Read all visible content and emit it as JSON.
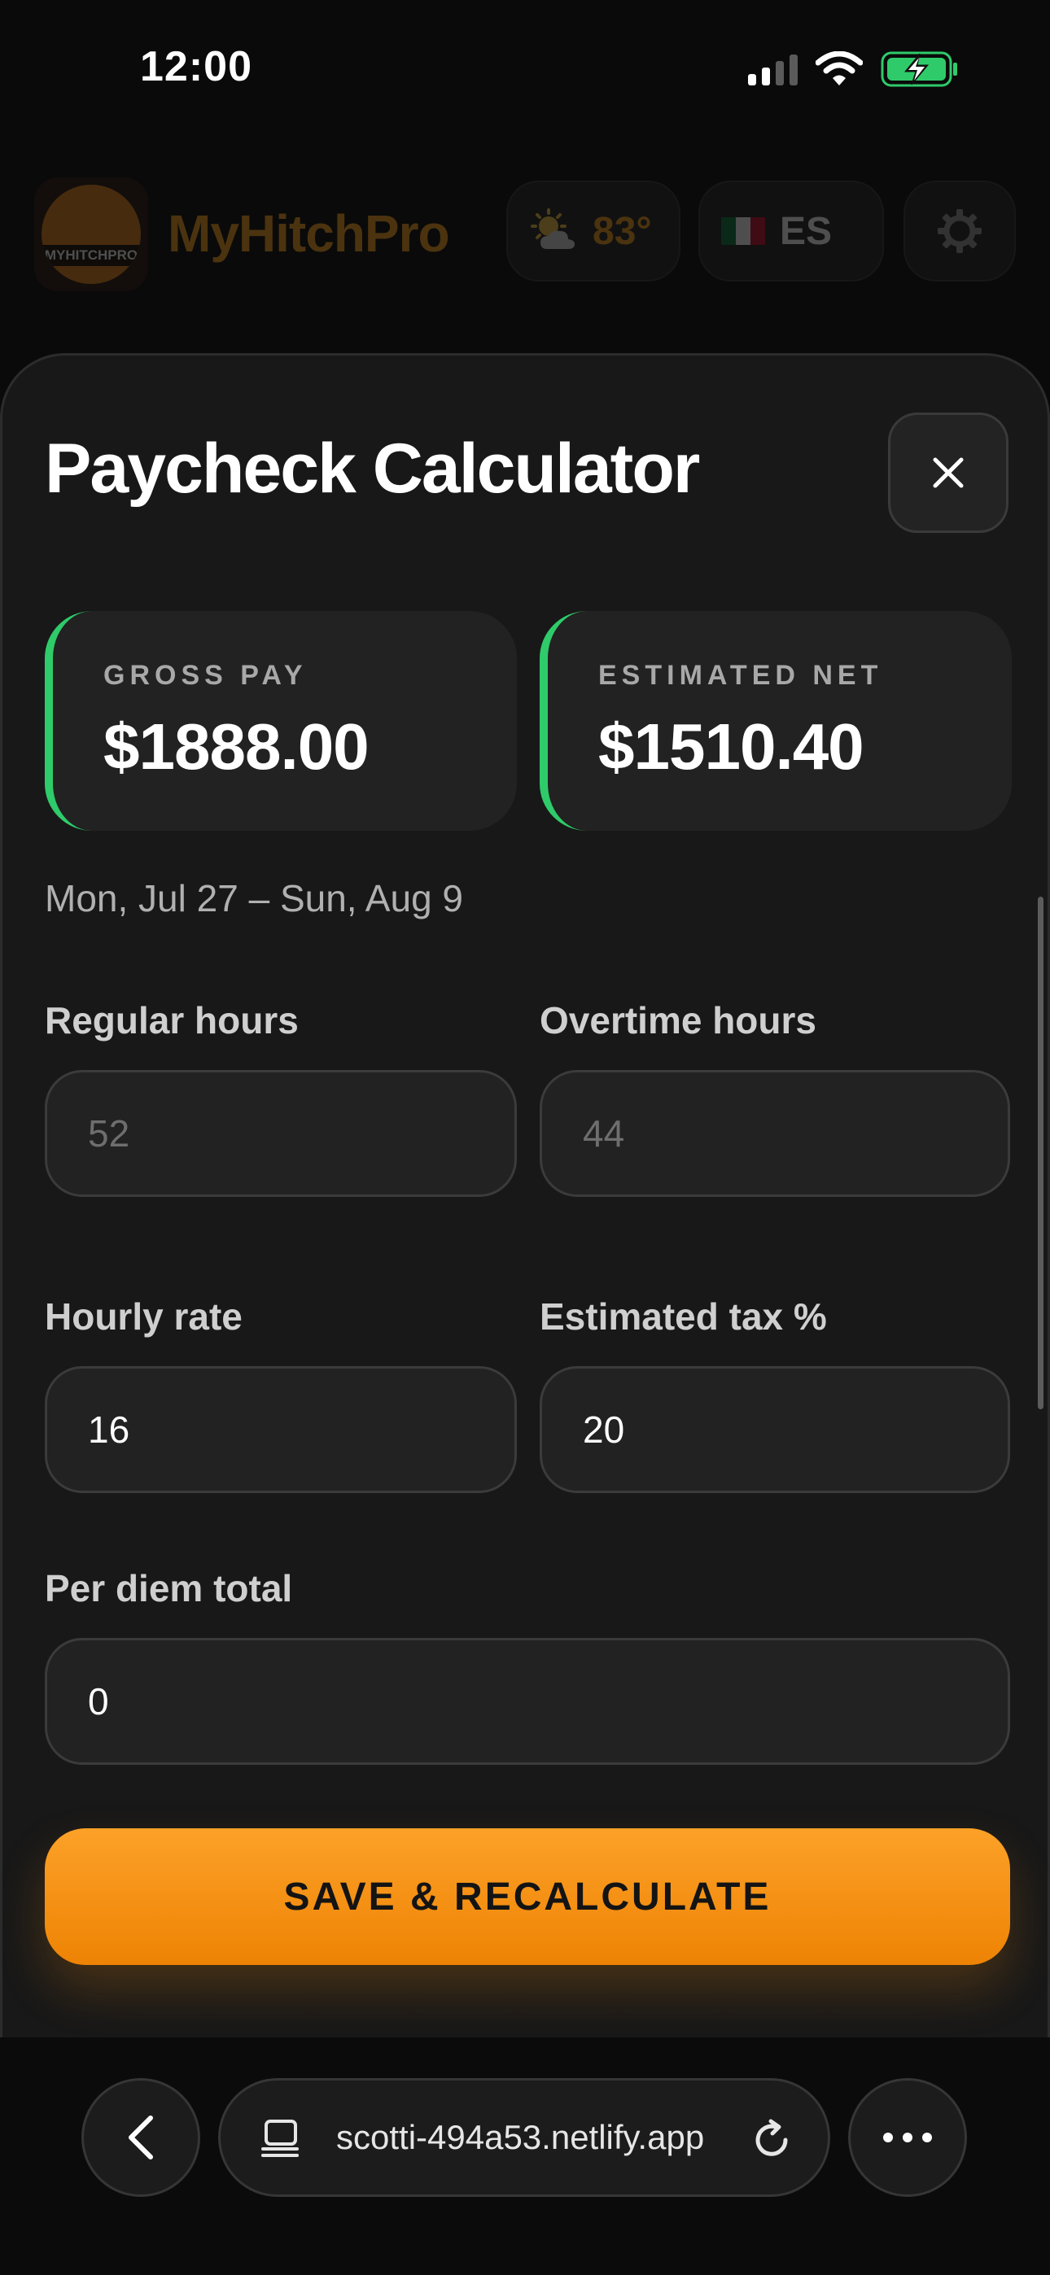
{
  "status_bar": {
    "time": "12:00"
  },
  "header": {
    "app_name": "MyHitchPro",
    "logo_text": "MYHITCHPRO",
    "weather": "83°",
    "language": "ES"
  },
  "modal": {
    "title": "Paycheck Calculator",
    "gross": {
      "label": "GROSS PAY",
      "value": "$1888.00"
    },
    "net": {
      "label": "ESTIMATED NET",
      "value": "$1510.40"
    },
    "date_range": "Mon, Jul 27 – Sun, Aug 9",
    "fields": {
      "regular_hours": {
        "label": "Regular hours",
        "placeholder": "52"
      },
      "overtime_hours": {
        "label": "Overtime hours",
        "placeholder": "44"
      },
      "hourly_rate": {
        "label": "Hourly rate",
        "value": "16"
      },
      "tax": {
        "label": "Estimated tax %",
        "value": "20"
      },
      "per_diem": {
        "label": "Per diem total",
        "value": "0"
      }
    },
    "save_label": "SAVE & RECALCULATE"
  },
  "browser": {
    "url": "scotti-494a53.netlify.app"
  },
  "colors": {
    "accent_orange": "#f39c1f",
    "accent_green": "#2fcb6a",
    "background": "#0a0a0a",
    "sheet": "#181818"
  },
  "icons": [
    "battery-charging-icon",
    "wifi-icon",
    "signal-icon",
    "sun-cloud-icon",
    "mexico-flag-icon",
    "gear-icon",
    "close-icon",
    "back-chevron-icon",
    "tabs-icon",
    "reload-icon",
    "more-icon"
  ]
}
